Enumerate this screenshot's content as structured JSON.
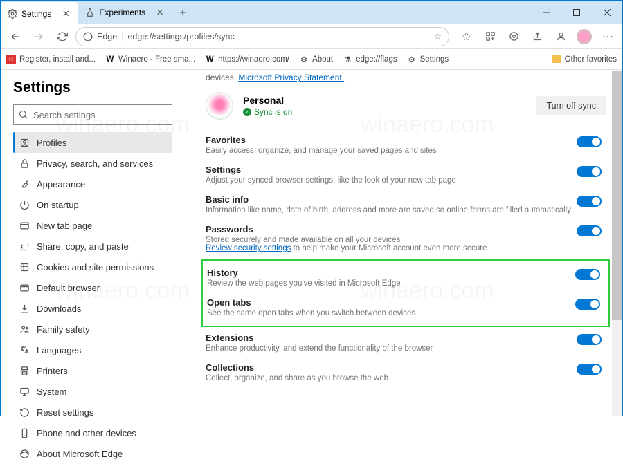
{
  "tabs": [
    {
      "label": "Settings"
    },
    {
      "label": "Experiments"
    }
  ],
  "addressbar": {
    "identity": "Edge",
    "url": "edge://settings/profiles/sync"
  },
  "bookmarks": [
    {
      "label": "Register, install and..."
    },
    {
      "label": "Winaero - Free sma..."
    },
    {
      "label": "https://winaero.com/"
    },
    {
      "label": "About"
    },
    {
      "label": "edge://flags"
    },
    {
      "label": "Settings"
    }
  ],
  "bookmarks_right": "Other favorites",
  "sidebar": {
    "title": "Settings",
    "search_placeholder": "Search settings",
    "items": [
      {
        "label": "Profiles"
      },
      {
        "label": "Privacy, search, and services"
      },
      {
        "label": "Appearance"
      },
      {
        "label": "On startup"
      },
      {
        "label": "New tab page"
      },
      {
        "label": "Share, copy, and paste"
      },
      {
        "label": "Cookies and site permissions"
      },
      {
        "label": "Default browser"
      },
      {
        "label": "Downloads"
      },
      {
        "label": "Family safety"
      },
      {
        "label": "Languages"
      },
      {
        "label": "Printers"
      },
      {
        "label": "System"
      },
      {
        "label": "Reset settings"
      },
      {
        "label": "Phone and other devices"
      },
      {
        "label": "About Microsoft Edge"
      }
    ]
  },
  "main": {
    "top_prefix": "devices. ",
    "top_link": "Microsoft Privacy Statement.",
    "profile_name": "Personal",
    "sync_status": "Sync is on",
    "turn_off": "Turn off sync",
    "items": [
      {
        "title": "Favorites",
        "desc": "Easily access, organize, and manage your saved pages and sites",
        "on": true
      },
      {
        "title": "Settings",
        "desc": "Adjust your synced browser settings, like the look of your new tab page",
        "on": true
      },
      {
        "title": "Basic info",
        "desc": "Information like name, date of birth, address and more are saved so online forms are filled automatically",
        "on": true
      },
      {
        "title": "Passwords",
        "desc": "Stored securely and made available on all your devices",
        "link": "Review security settings",
        "desc2": " to help make your Microsoft account even more secure",
        "on": true
      },
      {
        "title": "History",
        "desc": "Review the web pages you've visited in Microsoft Edge",
        "on": true
      },
      {
        "title": "Open tabs",
        "desc": "See the same open tabs when you switch between devices",
        "on": true
      },
      {
        "title": "Extensions",
        "desc": "Enhance productivity, and extend the functionality of the browser",
        "on": true
      },
      {
        "title": "Collections",
        "desc": "Collect, organize, and share as you browse the web",
        "on": true
      }
    ]
  },
  "watermark": "winaero.com"
}
